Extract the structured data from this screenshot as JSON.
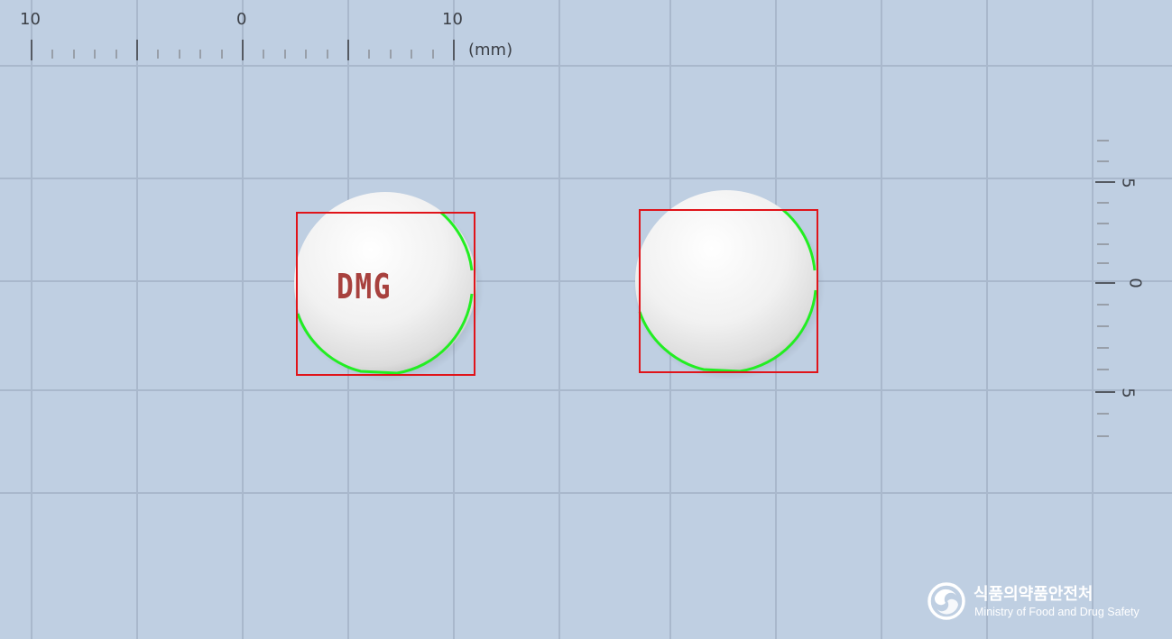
{
  "ruler_top": {
    "labels": [
      "10",
      "0",
      "10"
    ],
    "unit": "(mm)"
  },
  "ruler_right": {
    "labels": [
      "5",
      "0",
      "5"
    ]
  },
  "pills": [
    {
      "imprint": "DMG"
    },
    {
      "imprint": ""
    }
  ],
  "logo": {
    "korean": "식품의약품안전처",
    "english": "Ministry of Food and Drug Safety",
    "icon": "taegeuk-swirl-icon"
  },
  "colors": {
    "background": "#bfcfe2",
    "grid": "#a9b8cc",
    "bounding_box": "#e0141a",
    "contour": "#22ee22",
    "pill": "#f2f2f2",
    "imprint": "#a8413e"
  }
}
